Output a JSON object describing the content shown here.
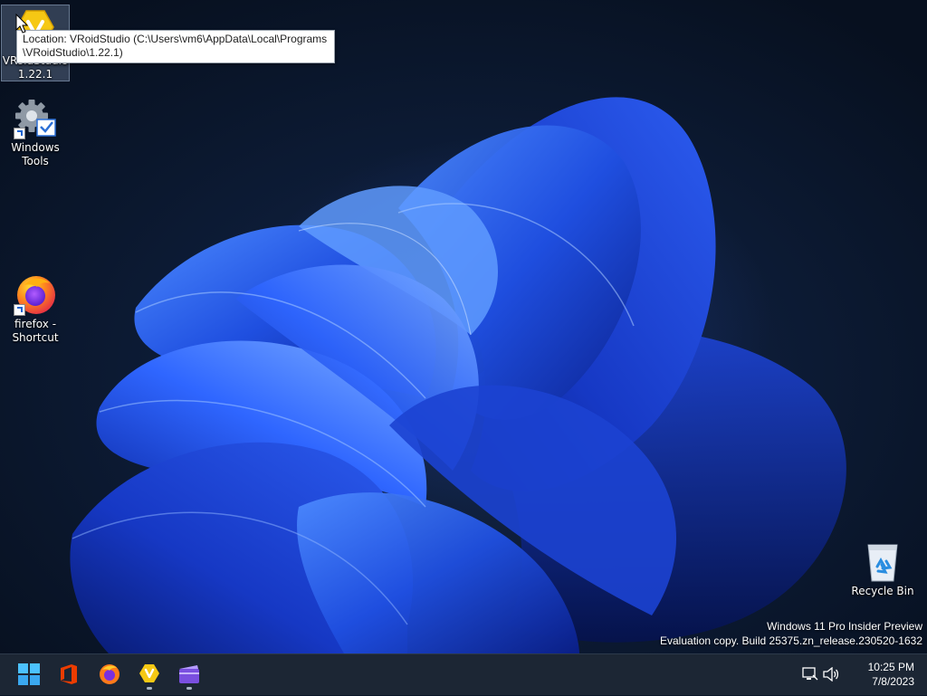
{
  "desktop": {
    "icons": [
      {
        "label_line1": "VRoidStudio",
        "label_line2": "1.22.1",
        "icon": "vroid-studio-icon",
        "selected": true
      },
      {
        "label_line1": "Windows",
        "label_line2": "Tools",
        "icon": "windows-tools-icon",
        "shortcut": true
      },
      {
        "label_line1": "firefox -",
        "label_line2": "Shortcut",
        "icon": "firefox-icon",
        "shortcut": true
      },
      {
        "label_line1": "Recycle Bin",
        "icon": "recycle-bin-icon"
      }
    ],
    "tooltip": "Location: VRoidStudio (C:\\Users\\vm6\\AppData\\Local\\Programs\\VRoidStudio\\1.22.1)",
    "watermark": {
      "line1": "Windows 11 Pro Insider Preview",
      "line2": "Evaluation copy. Build 25375.zn_release.230520-1632"
    }
  },
  "taskbar": {
    "apps": [
      {
        "name": "start-button",
        "icon": "windows-logo-icon"
      },
      {
        "name": "office",
        "icon": "office-icon"
      },
      {
        "name": "firefox",
        "icon": "firefox-icon"
      },
      {
        "name": "vroid-studio",
        "icon": "vroid-studio-icon",
        "running": true
      },
      {
        "name": "clipchamp",
        "icon": "clipchamp-icon",
        "running": true
      }
    ],
    "tray": {
      "network_icon": "network-icon",
      "volume_icon": "volume-icon",
      "time": "10:25 PM",
      "date": "7/8/2023"
    }
  },
  "colors": {
    "taskbar_bg": "#1c2634",
    "accent_blue": "#1f4fe0",
    "vroid_yellow": "#f6c814"
  }
}
